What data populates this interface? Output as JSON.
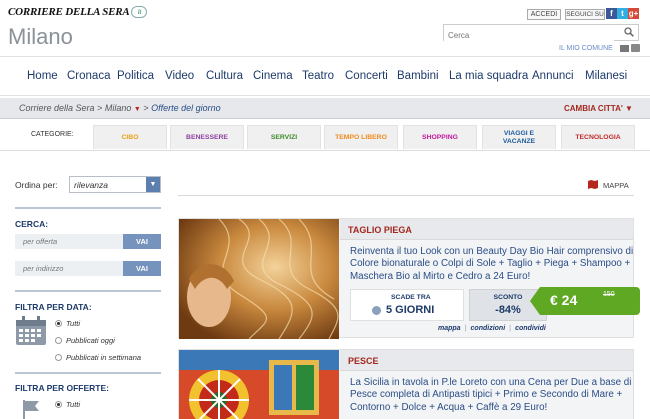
{
  "header": {
    "logo_text": "CORRIERE DELLA SERA",
    "logo_badge": "it",
    "city": "Milano",
    "accedi_label": "ACCEDI",
    "seguici_label": "SEGUICI SU",
    "social": [
      "f",
      "t",
      "g+"
    ],
    "search_placeholder": "Cerca",
    "mio_comune": "IL MIO COMUNE"
  },
  "nav": {
    "items": [
      "Home",
      "Cronaca",
      "Politica",
      "Video",
      "Cultura",
      "Cinema",
      "Teatro",
      "Concerti",
      "Bambini",
      "La mia squadra",
      "Annunci",
      "Milanesi"
    ]
  },
  "breadcrumb": {
    "items": [
      "Corriere della Sera",
      "Milano",
      "Offerte del giorno"
    ],
    "sep": ">",
    "cambia": "CAMBIA CITTA' ▼"
  },
  "categories": {
    "label": "CATEGORIE:",
    "items": [
      {
        "label": "CIBO",
        "color": "#e8a21a"
      },
      {
        "label": "BENESSERE",
        "color": "#8b3fa0"
      },
      {
        "label": "SERVIZI",
        "color": "#3f8a2a"
      },
      {
        "label": "TEMPO LIBERO",
        "color": "#f08a1c"
      },
      {
        "label": "SHOPPING",
        "color": "#c2189a"
      },
      {
        "label": "VIAGGI E\nVACANZE",
        "color": "#1d5a9c"
      },
      {
        "label": "TECNOLOGIA",
        "color": "#c32a2a"
      }
    ]
  },
  "sidebar": {
    "sort_label": "Ordina per:",
    "sort_value": "rilevanza",
    "cerca_head": "CERCA:",
    "offerta_placeholder": "per offerta",
    "indirizzo_placeholder": "per indirizzo",
    "vai_label": "VAI",
    "filtra_data_head": "FILTRA PER DATA:",
    "data_options": [
      "Tutti",
      "Pubblicati oggi",
      "Pubblicati in settimana"
    ],
    "filtra_offerte_head": "FILTRA PER OFFERTE:",
    "offerte_options": [
      "Tutti"
    ]
  },
  "main": {
    "mappa_label": "MAPPA",
    "cards": [
      {
        "title": "TAGLIO PIEGA",
        "description": "Reinventa il tuo Look con un Beauty Day Bio Hair comprensivo di Colore bionaturale o Colpi di Sole + Taglio + Piega + Shampoo + Maschera Bio al Mirto e Cedro a 24 Euro!",
        "scade_label": "SCADE TRA",
        "scade_value": "5 GIORNI",
        "sconto_label": "SCONTO",
        "sconto_value": "-84%",
        "price_now": "€ 24",
        "price_old": "150",
        "links": [
          "mappa",
          "condizioni",
          "condividi"
        ]
      },
      {
        "title": "PESCE",
        "description": "La Sicilia in tavola in P.le Loreto con una Cena per Due a base di Pesce completa di Antipasti tipici + Primo e Secondo di Mare + Contorno + Dolce + Acqua + Caffè a 29 Euro!"
      }
    ]
  }
}
